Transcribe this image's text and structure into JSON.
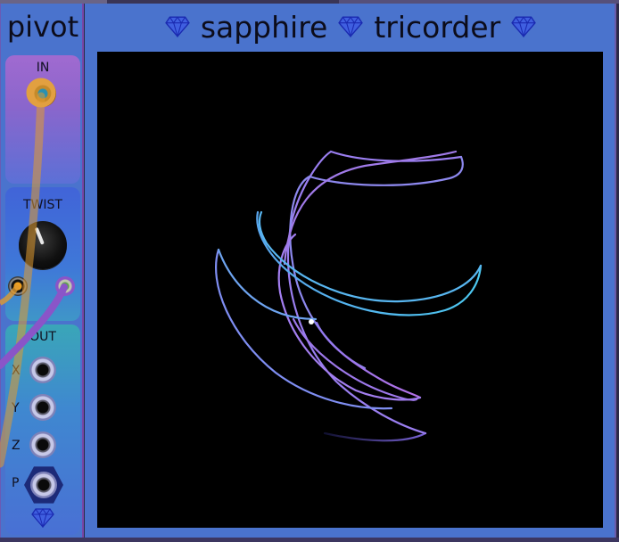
{
  "pivot": {
    "title": "pivot",
    "input_label": "IN",
    "twist_label": "TWIST",
    "output_label": "OUT",
    "outputs": [
      "X",
      "Y",
      "Z",
      "P"
    ]
  },
  "tricorder": {
    "title_left": "sapphire",
    "title_right": "tricorder"
  },
  "colors": {
    "panel": "#4a73cd",
    "screen": "#000000",
    "trace_blue": "#4fc2ee",
    "trace_purple": "#9b6ee8",
    "cable_orange": "#e09a30",
    "cable_purple": "#8a55c8"
  },
  "icons": [
    "gem-icon",
    "gem-icon",
    "gem-icon",
    "gem-icon"
  ]
}
